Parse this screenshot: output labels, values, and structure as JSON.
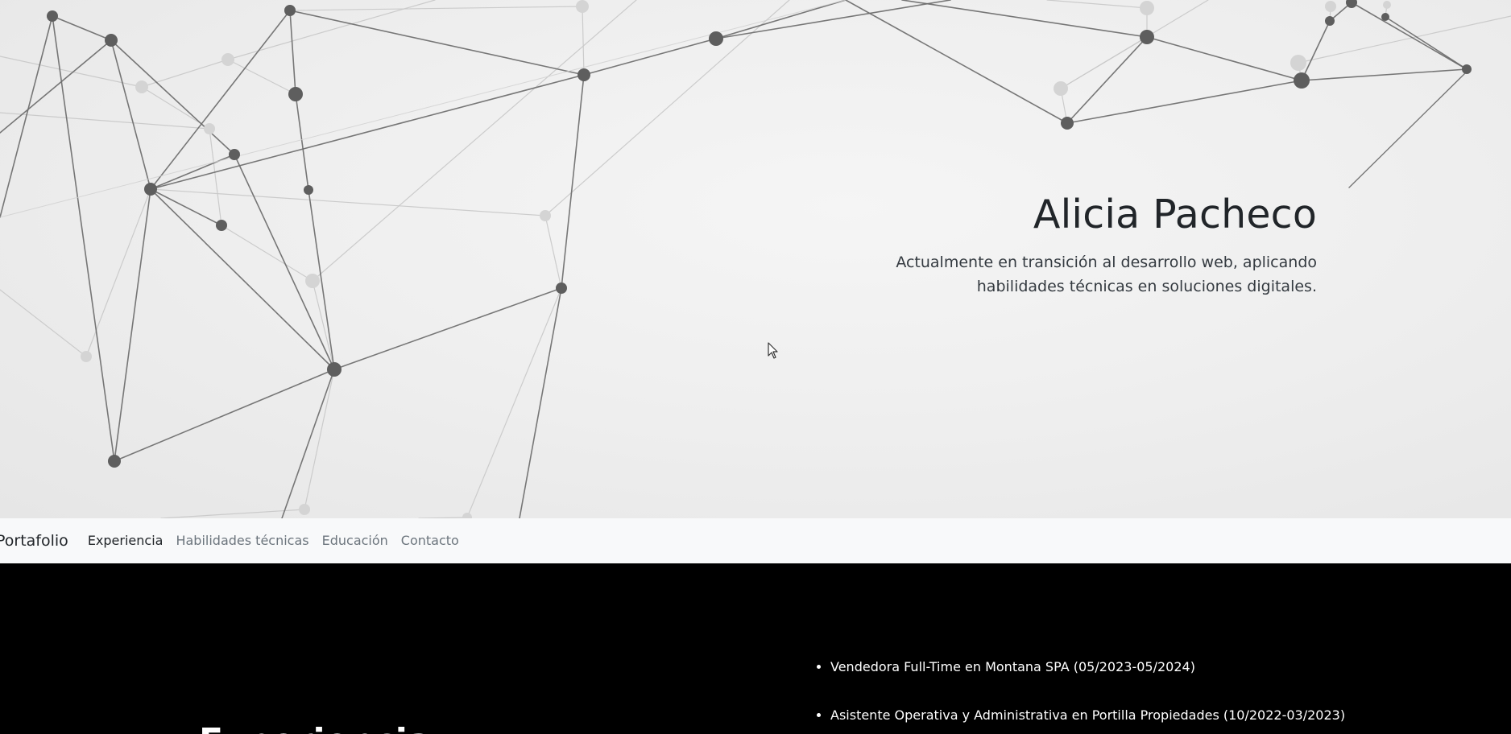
{
  "hero": {
    "name": "Alicia Pacheco",
    "tagline_line1": "Actualmente en transición al desarrollo web, aplicando",
    "tagline_line2": "habilidades técnicas en soluciones digitales."
  },
  "navbar": {
    "brand": "Portafolio",
    "links": [
      {
        "label": "Experiencia",
        "active": true
      },
      {
        "label": "Habilidades técnicas",
        "active": false
      },
      {
        "label": "Educación",
        "active": false
      },
      {
        "label": "Contacto",
        "active": false
      }
    ]
  },
  "experience": {
    "heading": "Experiencia",
    "items": [
      "Vendedora Full-Time en Montana SPA (05/2023-05/2024)",
      "Asistente Operativa y Administrativa en Portilla Propiedades (10/2022-03/2023)"
    ]
  },
  "colors": {
    "hero_background": "#efefef",
    "node_dark": "#5e5e5e",
    "node_light": "#d4d4d4",
    "navbar_background": "#f8f9fa",
    "section_background": "#000000",
    "text_dark": "#212529",
    "nav_muted": "#6c757d"
  }
}
